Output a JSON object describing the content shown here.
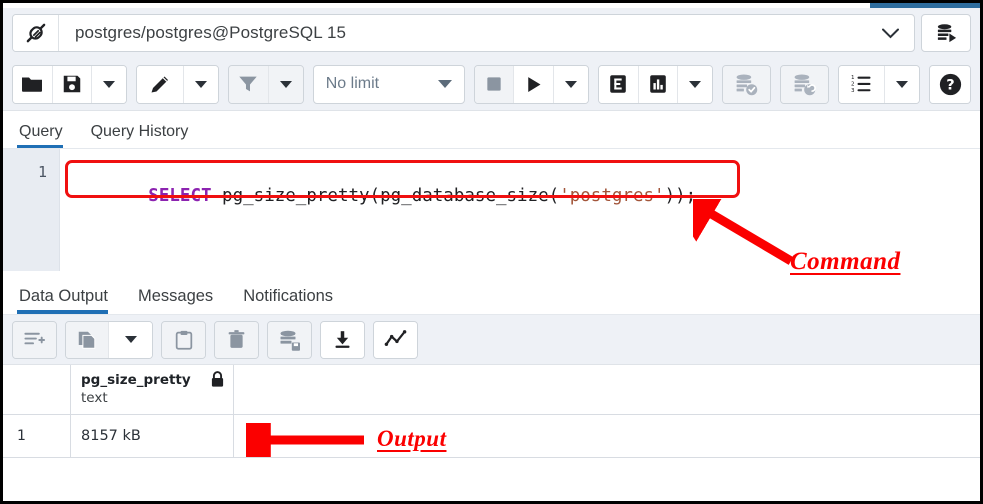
{
  "window": {
    "accent_blue": "#1f6fb5",
    "annotation_red": "#fb0000",
    "toolbar_bg": "#eef1f6"
  },
  "connection_bar": {
    "icon": "connection-plug-icon",
    "label": "postgres/postgres@PostgreSQL 15",
    "dropdown_icon": "chevron-down-icon",
    "db_button_icon": "database-connect-icon"
  },
  "toolbar": {
    "groups": [
      {
        "buttons": [
          {
            "name": "open-file-button",
            "icon": "folder-icon",
            "dim": false
          },
          {
            "name": "save-file-button",
            "icon": "floppy-disk-icon",
            "dim": false
          },
          {
            "name": "save-file-dropdown",
            "icon": "chevron-down-icon",
            "dim": false
          }
        ]
      },
      {
        "buttons": [
          {
            "name": "edit-button",
            "icon": "pencil-icon",
            "dim": false
          },
          {
            "name": "edit-dropdown",
            "icon": "chevron-down-icon",
            "dim": false
          }
        ]
      },
      {
        "buttons": [
          {
            "name": "filter-button",
            "icon": "funnel-icon",
            "dim": true
          },
          {
            "name": "filter-dropdown",
            "icon": "chevron-down-icon",
            "dim": true
          }
        ]
      }
    ],
    "row_limit": {
      "label": "No limit",
      "icon": "triangle-down-icon"
    },
    "groups_right": [
      {
        "buttons": [
          {
            "name": "stop-query-button",
            "icon": "stop-square-icon",
            "dim": true
          },
          {
            "name": "execute-query-button",
            "icon": "play-triangle-icon",
            "dim": false
          },
          {
            "name": "execute-dropdown",
            "icon": "chevron-down-icon",
            "dim": false
          }
        ]
      },
      {
        "buttons": [
          {
            "name": "explain-button",
            "icon": "explain-e-icon",
            "dim": false
          },
          {
            "name": "explain-analyze-button",
            "icon": "bar-chart-icon",
            "dim": false
          },
          {
            "name": "explain-dropdown",
            "icon": "chevron-down-icon",
            "dim": false
          }
        ]
      },
      {
        "buttons": [
          {
            "name": "commit-button",
            "icon": "database-check-icon",
            "dim": true
          }
        ]
      },
      {
        "buttons": [
          {
            "name": "rollback-button",
            "icon": "database-undo-icon",
            "dim": true
          }
        ]
      },
      {
        "buttons": [
          {
            "name": "macros-button",
            "icon": "numbered-list-icon",
            "dim": false
          },
          {
            "name": "macros-dropdown",
            "icon": "chevron-down-icon",
            "dim": false
          }
        ]
      },
      {
        "buttons": [
          {
            "name": "help-button",
            "icon": "question-circle-icon",
            "dim": false
          }
        ]
      }
    ]
  },
  "query_tabs": [
    {
      "label": "Query",
      "active": true
    },
    {
      "label": "Query History",
      "active": false
    }
  ],
  "editor": {
    "line_number": "1",
    "sql_tokens": [
      {
        "text": "SELECT",
        "type": "keyword"
      },
      {
        "text": " pg_size_pretty(pg_database_size(",
        "type": "plain"
      },
      {
        "text": "'postgres'",
        "type": "string"
      },
      {
        "text": "));",
        "type": "plain"
      }
    ],
    "sql_full": "SELECT pg_size_pretty(pg_database_size('postgres'));"
  },
  "output_tabs": [
    {
      "label": "Data Output",
      "active": true
    },
    {
      "label": "Messages",
      "active": false
    },
    {
      "label": "Notifications",
      "active": false
    }
  ],
  "output_toolbar": {
    "groups": [
      {
        "buttons": [
          {
            "name": "add-row-button",
            "icon": "rows-plus-icon",
            "dim": true
          }
        ]
      },
      {
        "buttons": [
          {
            "name": "copy-button",
            "icon": "copy-pages-icon",
            "dim": true
          },
          {
            "name": "copy-dropdown",
            "icon": "chevron-down-icon",
            "dim": false
          }
        ]
      },
      {
        "buttons": [
          {
            "name": "paste-button",
            "icon": "clipboard-icon",
            "dim": true
          }
        ]
      },
      {
        "buttons": [
          {
            "name": "delete-row-button",
            "icon": "trash-icon",
            "dim": true
          }
        ]
      },
      {
        "buttons": [
          {
            "name": "save-data-changes-button",
            "icon": "database-save-icon",
            "dim": true
          }
        ]
      },
      {
        "buttons": [
          {
            "name": "download-csv-button",
            "icon": "download-arrow-icon",
            "dim": false
          }
        ]
      },
      {
        "buttons": [
          {
            "name": "graph-visualiser-button",
            "icon": "line-graph-icon",
            "dim": false
          }
        ]
      }
    ]
  },
  "result_grid": {
    "columns": [
      {
        "name": "pg_size_pretty",
        "type": "text",
        "lock_icon": "lock-icon"
      }
    ],
    "rows": [
      {
        "row_number": "1",
        "cells": [
          "8157 kB"
        ]
      }
    ]
  },
  "annotations": [
    {
      "name": "annotation-command",
      "label": "Command"
    },
    {
      "name": "annotation-output",
      "label": "Output"
    }
  ]
}
